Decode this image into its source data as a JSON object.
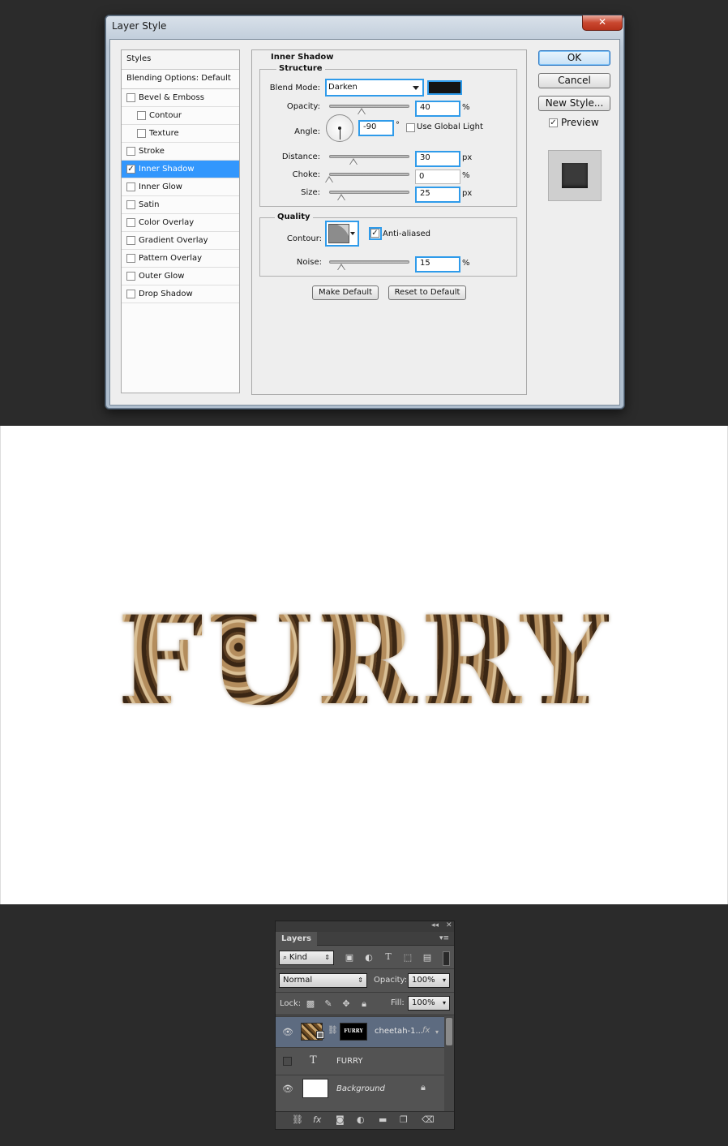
{
  "dialog": {
    "title": "Layer Style",
    "close_label": "✕",
    "styles_header": "Styles",
    "blending_options": "Blending Options: Default",
    "style_items": [
      {
        "label": "Bevel & Emboss",
        "checked": false,
        "sub": false,
        "selected": false
      },
      {
        "label": "Contour",
        "checked": false,
        "sub": true,
        "selected": false
      },
      {
        "label": "Texture",
        "checked": false,
        "sub": true,
        "selected": false
      },
      {
        "label": "Stroke",
        "checked": false,
        "sub": false,
        "selected": false
      },
      {
        "label": "Inner Shadow",
        "checked": true,
        "sub": false,
        "selected": true
      },
      {
        "label": "Inner Glow",
        "checked": false,
        "sub": false,
        "selected": false
      },
      {
        "label": "Satin",
        "checked": false,
        "sub": false,
        "selected": false
      },
      {
        "label": "Color Overlay",
        "checked": false,
        "sub": false,
        "selected": false
      },
      {
        "label": "Gradient Overlay",
        "checked": false,
        "sub": false,
        "selected": false
      },
      {
        "label": "Pattern Overlay",
        "checked": false,
        "sub": false,
        "selected": false
      },
      {
        "label": "Outer Glow",
        "checked": false,
        "sub": false,
        "selected": false
      },
      {
        "label": "Drop Shadow",
        "checked": false,
        "sub": false,
        "selected": false
      }
    ],
    "section_title": "Inner Shadow",
    "structure": {
      "title": "Structure",
      "blend_mode_label": "Blend Mode:",
      "blend_mode_value": "Darken",
      "shadow_color": "#141414",
      "opacity_label": "Opacity:",
      "opacity_value": "40",
      "opacity_level": 0.4,
      "opacity_unit": "%",
      "angle_label": "Angle:",
      "angle_value": "-90",
      "angle_unit": "°",
      "global_light_label": "Use Global Light",
      "global_light_checked": false,
      "distance_label": "Distance:",
      "distance_value": "30",
      "distance_level": 0.3,
      "distance_unit": "px",
      "choke_label": "Choke:",
      "choke_value": "0",
      "choke_level": 0,
      "choke_unit": "%",
      "size_label": "Size:",
      "size_value": "25",
      "size_level": 0.15,
      "size_unit": "px"
    },
    "quality": {
      "title": "Quality",
      "contour_label": "Contour:",
      "antialiased_label": "Anti-aliased",
      "antialiased_checked": true,
      "noise_label": "Noise:",
      "noise_value": "15",
      "noise_level": 0.15,
      "noise_unit": "%"
    },
    "make_default": "Make Default",
    "reset_default": "Reset to Default",
    "ok": "OK",
    "cancel": "Cancel",
    "new_style": "New Style...",
    "preview_label": "Preview",
    "preview_checked": true
  },
  "canvas": {
    "text": "FURRY"
  },
  "layers_panel": {
    "collapse_icon": "collapse-icon",
    "tab": "Layers",
    "filter_kind": "Kind",
    "blend_mode": "Normal",
    "opacity_label": "Opacity:",
    "opacity_value": "100%",
    "lock_label": "Lock:",
    "fill_label": "Fill:",
    "fill_value": "100%",
    "layers": [
      {
        "name": "cheetah-1...",
        "fx": "fx",
        "visible": true,
        "selected": true,
        "type": "smart-object-with-mask",
        "mask_text": "FURRY"
      },
      {
        "name": "FURRY",
        "visible": false,
        "selected": false,
        "type": "text"
      },
      {
        "name": "Background",
        "visible": true,
        "selected": false,
        "type": "background",
        "locked": true
      }
    ],
    "bottom_icons": [
      "link-icon",
      "fx-icon",
      "mask-icon",
      "adjustment-icon",
      "folder-icon",
      "new-layer-icon",
      "trash-icon"
    ],
    "fx_glyph": "fx"
  }
}
